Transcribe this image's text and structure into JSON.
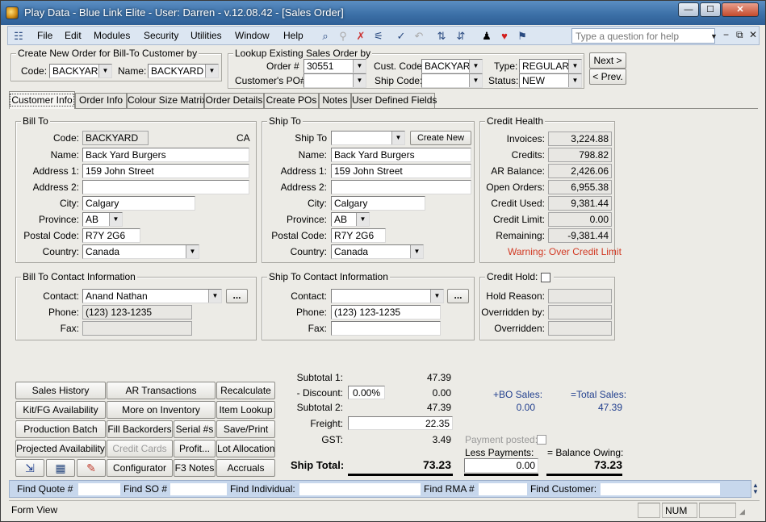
{
  "window": {
    "title": "Play Data - Blue Link Elite - User: Darren - v.12.08.42 - [Sales Order]",
    "min": "—",
    "max": "☐",
    "close": "✕"
  },
  "menu": {
    "items": [
      "File",
      "Edit",
      "Modules",
      "Security",
      "Utilities",
      "Window",
      "Help"
    ],
    "help_placeholder": "Type a question for help",
    "mdi": [
      "−",
      "⧉",
      "✕"
    ]
  },
  "create_new": {
    "title": "Create New Order for Bill-To Customer by",
    "code_label": "Code:",
    "code_value": "BACKYARD",
    "name_label": "Name:",
    "name_value": "BACKYARD"
  },
  "lookup": {
    "title": "Lookup Existing Sales Order by",
    "order_label": "Order #",
    "order_value": "30551",
    "po_label": "Customer's PO#",
    "po_value": "",
    "cust_code_label": "Cust. Code",
    "cust_code_value": "BACKYARD",
    "ship_code_label": "Ship Code:",
    "ship_code_value": "",
    "type_label": "Type:",
    "type_value": "REGULAR",
    "status_label": "Status:",
    "status_value": "NEW",
    "next_label": "Next >",
    "prev_label": "< Prev."
  },
  "tabs": [
    "Customer Info",
    "Order Info",
    "Colour Size Matrix",
    "Order Details",
    "Create POs",
    "Notes",
    "User Defined Fields"
  ],
  "bill_to": {
    "title": "Bill To",
    "code_label": "Code:",
    "code": "BACKYARD",
    "country_code": "CA",
    "name_label": "Name:",
    "name": "Back Yard Burgers",
    "address1_label": "Address 1:",
    "address1": "159 John Street",
    "address2_label": "Address 2:",
    "address2": "",
    "city_label": "City:",
    "city": "Calgary",
    "province_label": "Province:",
    "province": "AB",
    "postal_label": "Postal Code:",
    "postal": "R7Y 2G6",
    "country_label": "Country:",
    "country": "Canada"
  },
  "ship_to": {
    "title": "Ship To",
    "shipto_label": "Ship To",
    "shipto": "",
    "create_new": "Create New",
    "name_label": "Name:",
    "name": "Back Yard Burgers",
    "address1_label": "Address 1:",
    "address1": "159 John Street",
    "address2_label": "Address 2:",
    "address2": "",
    "city_label": "City:",
    "city": "Calgary",
    "province_label": "Province:",
    "province": "AB",
    "postal_label": "Postal Code:",
    "postal": "R7Y 2G6",
    "country_label": "Country:",
    "country": "Canada"
  },
  "credit_health": {
    "title": "Credit Health",
    "invoices_label": "Invoices:",
    "invoices": "3,224.88",
    "credits_label": "Credits:",
    "credits": "798.82",
    "ar_label": "AR Balance:",
    "ar": "2,426.06",
    "open_label": "Open Orders:",
    "open": "6,955.38",
    "used_label": "Credit Used:",
    "used": "9,381.44",
    "limit_label": "Credit Limit:",
    "limit": "0.00",
    "remaining_label": "Remaining:",
    "remaining": "-9,381.44",
    "warning": "Warning: Over Credit Limit"
  },
  "bill_contact": {
    "title": "Bill To Contact Information",
    "contact_label": "Contact:",
    "contact": "Anand Nathan",
    "phone_label": "Phone:",
    "phone": "(123) 123-1235",
    "fax_label": "Fax:",
    "fax": "",
    "more": "..."
  },
  "ship_contact": {
    "title": "Ship To Contact Information",
    "contact_label": "Contact:",
    "contact": "",
    "phone_label": "Phone:",
    "phone": "(123) 123-1235",
    "fax_label": "Fax:",
    "fax": "",
    "more": "..."
  },
  "credit_hold": {
    "title": "Credit Hold:",
    "reason_label": "Hold Reason:",
    "reason": "",
    "by_label": "Overridden by:",
    "by": "",
    "on_label": "Overridden:",
    "on": ""
  },
  "actions": {
    "sales_history": "Sales History",
    "ar_transactions": "AR Transactions",
    "recalculate": "Recalculate",
    "kit_fg": "Kit/FG Availability",
    "more_inventory": "More on Inventory",
    "item_lookup": "Item Lookup",
    "production_batch": "Production Batch",
    "fill_backorders": "Fill Backorders",
    "serials": "Serial #s",
    "save_print": "Save/Print",
    "projected": "Projected Availability",
    "credit_cards": "Credit Cards",
    "profit": "Profit...",
    "lot_allocation": "Lot Allocation",
    "configurator": "Configurator",
    "f3notes": "F3 Notes",
    "accruals": "Accruals"
  },
  "totals": {
    "subtotal1_label": "Subtotal 1:",
    "subtotal1": "47.39",
    "discount_label": "- Discount:",
    "discount_pct": "0.00%",
    "discount": "0.00",
    "subtotal2_label": "Subtotal 2:",
    "subtotal2": "47.39",
    "freight_label": "Freight:",
    "freight": "22.35",
    "gst_label": "GST:",
    "gst": "3.49",
    "ship_total_label": "Ship Total:",
    "ship_total": "73.23",
    "bo_sales_label": "+BO Sales:",
    "bo_sales": "0.00",
    "total_sales_label": "=Total Sales:",
    "total_sales": "47.39",
    "payment_posted_label": "Payment posted:",
    "less_payments_label": "Less Payments:",
    "less_payments": "0.00",
    "balance_label": "= Balance Owing:",
    "balance": "73.23"
  },
  "findbar": {
    "quote": "Find Quote #",
    "so": "Find SO #",
    "individual": "Find Individual:",
    "rma": "Find RMA #",
    "customer": "Find Customer:"
  },
  "status": {
    "view": "Form View",
    "num": "NUM"
  },
  "colors": {
    "accent": "#3a6ea5",
    "warning": "#d23b25",
    "link": "#213f8e"
  }
}
